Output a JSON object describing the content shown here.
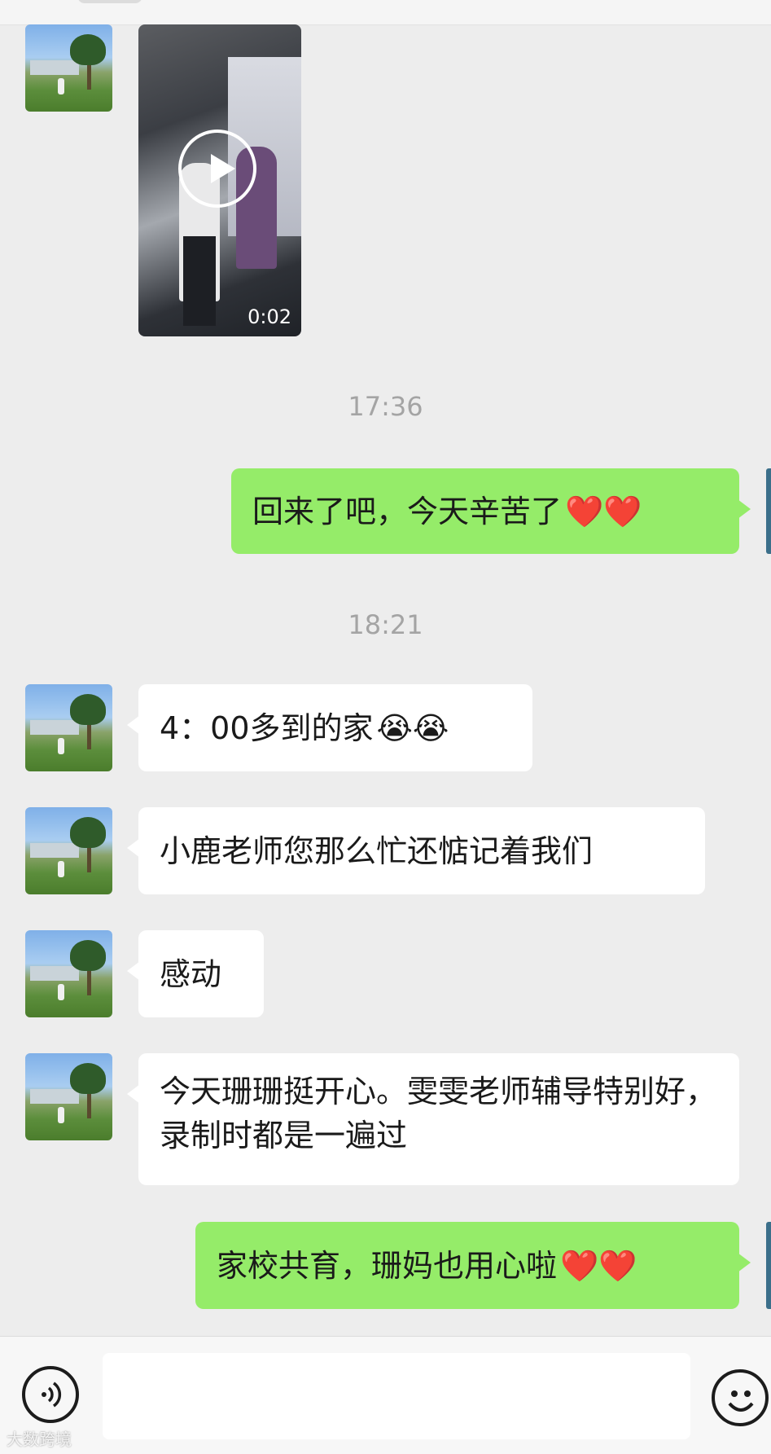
{
  "chat": {
    "video": {
      "duration": "0:02"
    },
    "timestamps": [
      "17:36",
      "18:21"
    ],
    "messages": [
      {
        "side": "right",
        "text": "回来了吧，今天辛苦了",
        "emoji": "❤️❤️"
      },
      {
        "side": "left",
        "text": "4：00多到的家",
        "emoji": "😭😭"
      },
      {
        "side": "left",
        "text": "小鹿老师您那么忙还惦记着我们",
        "emoji": ""
      },
      {
        "side": "left",
        "text": "感动",
        "emoji": ""
      },
      {
        "side": "left",
        "text": "今天珊珊挺开心。雯雯老师辅导特别好，录制时都是一遍过",
        "emoji": ""
      },
      {
        "side": "right",
        "text": "家校共育，珊妈也用心啦",
        "emoji": "❤️❤️"
      }
    ]
  },
  "input_bar": {
    "voice_icon": "voice-icon",
    "emoji_icon": "emoji-face-icon"
  },
  "watermark": "大数跨境",
  "colors": {
    "background": "#ededed",
    "self_bubble": "#95ec69",
    "other_bubble": "#ffffff",
    "timestamp": "#a4a4a4"
  }
}
